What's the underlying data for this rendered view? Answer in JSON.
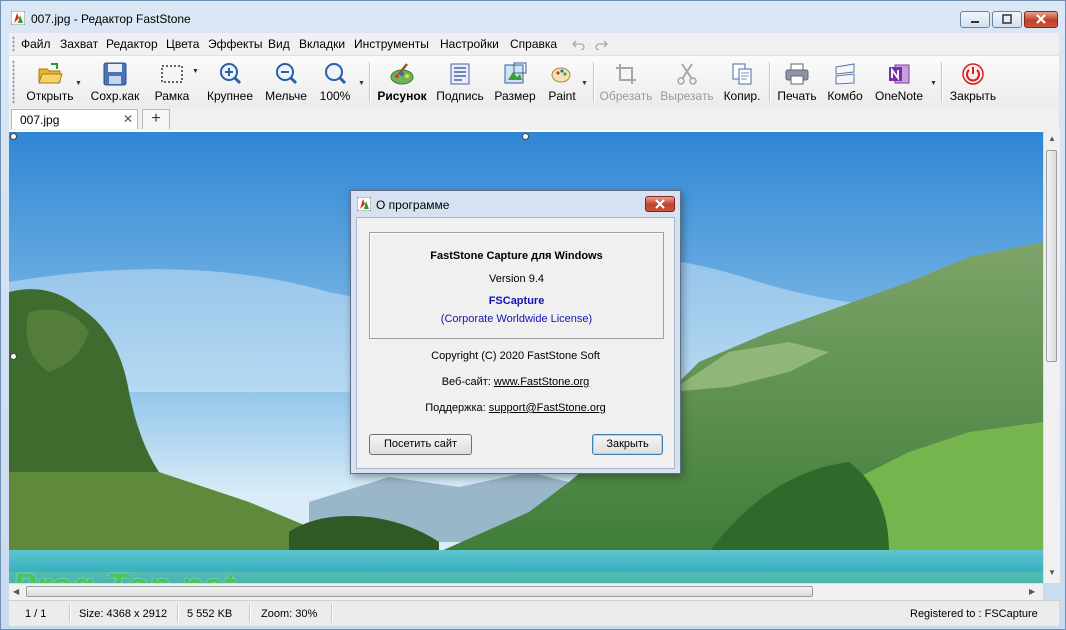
{
  "window": {
    "title": "007.jpg - Редактор FastStone"
  },
  "menu": [
    "Файл",
    "Захват",
    "Редактор",
    "Цвета",
    "Эффекты",
    "Вид",
    "Вкладки",
    "Инструменты",
    "Настройки",
    "Справка"
  ],
  "toolbar": {
    "open": "Открыть",
    "save_as": "Сохр.как",
    "frame": "Рамка",
    "zoom_in": "Крупнее",
    "zoom_out": "Мельче",
    "zoom_100": "100%",
    "draw": "Рисунок",
    "caption": "Подпись",
    "resize": "Размер",
    "paint": "Paint",
    "crop": "Обрезать",
    "cut": "Вырезать",
    "copy": "Копир.",
    "print": "Печать",
    "combo": "Комбо",
    "onenote": "OneNote",
    "close": "Закрыть"
  },
  "tabs": {
    "active": "007.jpg",
    "close": "✕",
    "add": "+"
  },
  "dialog": {
    "title": "О программе",
    "product": "FastStone Capture для Windows",
    "version": "Version 9.4",
    "reg_name": "FSCapture",
    "license": "(Corporate Worldwide License)",
    "copyright": "Copyright (C) 2020 FastStone Soft",
    "website_label": "Веб-сайт:",
    "website": "www.FastStone.org",
    "support_label": "Поддержка:",
    "support": "support@FastStone.org",
    "visit_button": "Посетить сайт",
    "close_button": "Закрыть"
  },
  "status": {
    "page": "1 / 1",
    "size": "Size: 4368 x 2912",
    "filesize": "5 552 KB",
    "zoom": "Zoom: 30%",
    "registered": "Registered to : FSCapture"
  },
  "watermark": "Prog-Top.net",
  "colors": {
    "link": "#1a1ad0",
    "accent_blue": "#1414b4"
  }
}
